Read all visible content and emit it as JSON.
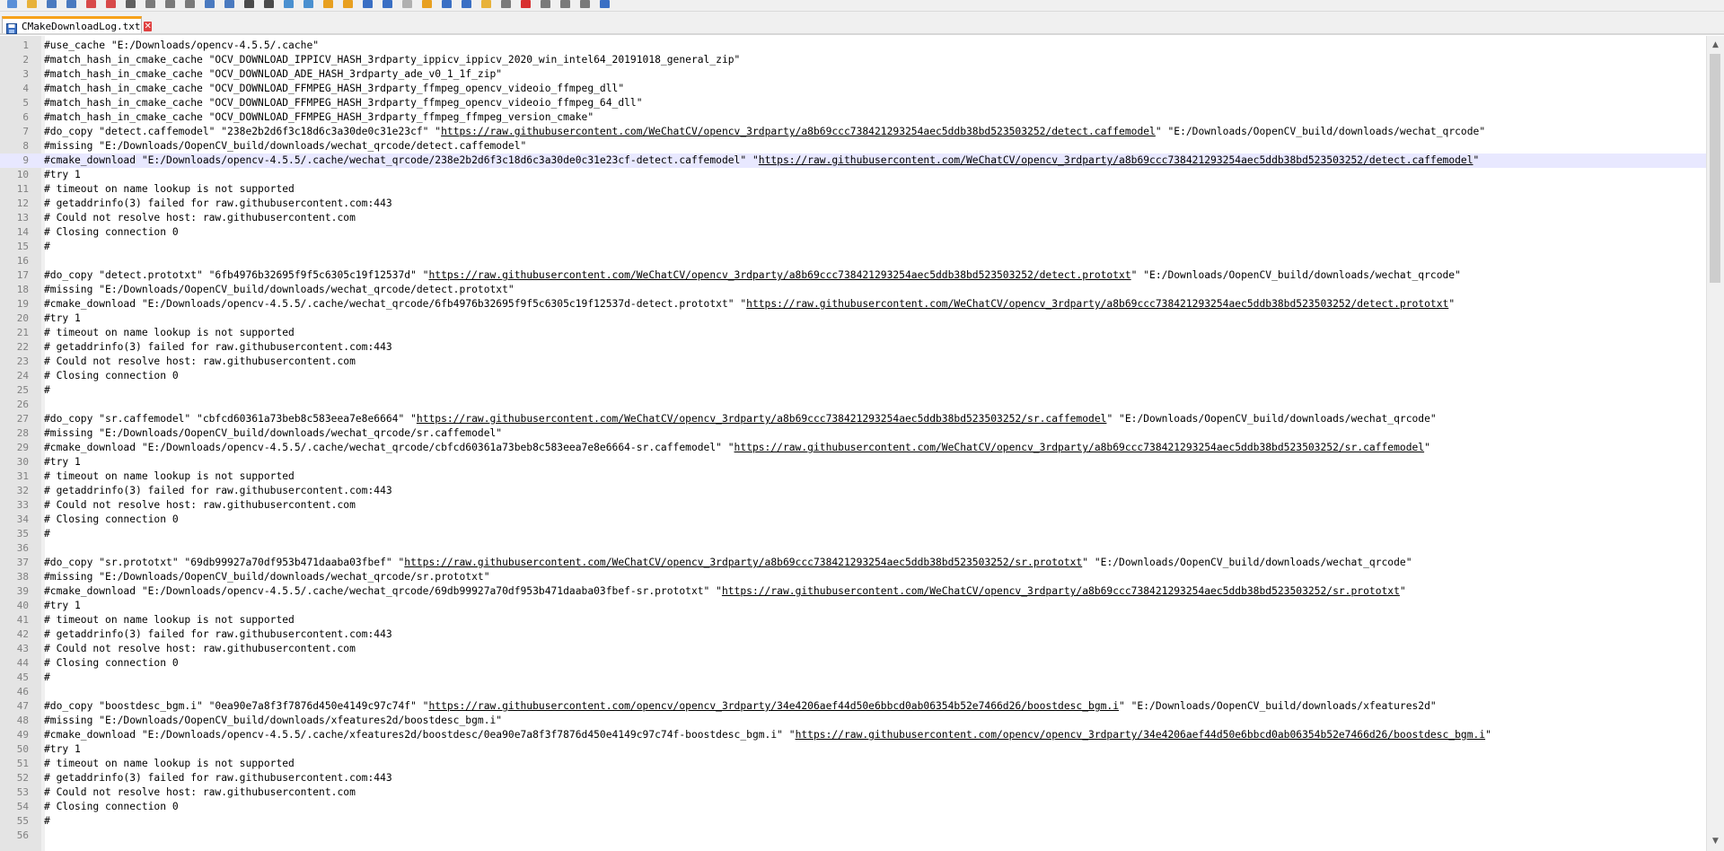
{
  "toolbar": {
    "icons": [
      "new-file-icon",
      "open-icon",
      "save-icon",
      "save-all-icon",
      "close-icon",
      "close-all-icon",
      "print-icon",
      "cut-icon",
      "copy-icon",
      "paste-icon",
      "undo-icon",
      "redo-icon",
      "find-icon",
      "replace-icon",
      "zoom-in-icon",
      "zoom-out-icon",
      "sync-vertical-icon",
      "sync-horizontal-icon",
      "word-wrap-icon",
      "show-all-chars-icon",
      "indent-guide-icon",
      "udl-icon",
      "doc-map-icon",
      "function-list-icon",
      "folder-workspace-icon",
      "monitoring-icon",
      "record-macro-icon",
      "stop-record-icon",
      "play-macro-icon",
      "run-macro-icon",
      "save-macro-icon"
    ]
  },
  "tab": {
    "title": "CMakeDownloadLog.txt",
    "close_glyph": "✕"
  },
  "colors": {
    "accent": "#f7a21a",
    "current_line": "#e8e8ff",
    "gutter": "#e4e4e4"
  },
  "current_line": 9,
  "lines": [
    {
      "n": "1",
      "text": "#use_cache \"E:/Downloads/opencv-4.5.5/.cache\""
    },
    {
      "n": "2",
      "text": "#match_hash_in_cmake_cache \"OCV_DOWNLOAD_IPPICV_HASH_3rdparty_ippicv_ippicv_2020_win_intel64_20191018_general_zip\""
    },
    {
      "n": "3",
      "text": "#match_hash_in_cmake_cache \"OCV_DOWNLOAD_ADE_HASH_3rdparty_ade_v0_1_1f_zip\""
    },
    {
      "n": "4",
      "text": "#match_hash_in_cmake_cache \"OCV_DOWNLOAD_FFMPEG_HASH_3rdparty_ffmpeg_opencv_videoio_ffmpeg_dll\""
    },
    {
      "n": "5",
      "text": "#match_hash_in_cmake_cache \"OCV_DOWNLOAD_FFMPEG_HASH_3rdparty_ffmpeg_opencv_videoio_ffmpeg_64_dll\""
    },
    {
      "n": "6",
      "text": "#match_hash_in_cmake_cache \"OCV_DOWNLOAD_FFMPEG_HASH_3rdparty_ffmpeg_ffmpeg_version_cmake\""
    },
    {
      "n": "7",
      "pre": "#do_copy \"detect.caffemodel\" \"238e2b2d6f3c18d6c3a30de0c31e23cf\" \"",
      "url": "https://raw.githubusercontent.com/WeChatCV/opencv_3rdparty/a8b69ccc738421293254aec5ddb38bd523503252/detect.caffemodel",
      "post": "\" \"E:/Downloads/OopenCV_build/downloads/wechat_qrcode\""
    },
    {
      "n": "8",
      "text": "#missing \"E:/Downloads/OopenCV_build/downloads/wechat_qrcode/detect.caffemodel\""
    },
    {
      "n": "9",
      "pre": "#cmake_download \"E:/Downloads/opencv-4.5.5/.cache/wechat_qrcode/238e2b2d6f3c18d6c3a30de0c31e23cf-detect.caffemodel\" \"",
      "url": "https://raw.githubusercontent.com/WeChatCV/opencv_3rdparty/a8b69ccc738421293254aec5ddb38bd523503252/detect.caffemodel",
      "post": "\""
    },
    {
      "n": "10",
      "text": "#try 1"
    },
    {
      "n": "11",
      "text": "# timeout on name lookup is not supported"
    },
    {
      "n": "12",
      "text": "# getaddrinfo(3) failed for raw.githubusercontent.com:443"
    },
    {
      "n": "13",
      "text": "# Could not resolve host: raw.githubusercontent.com"
    },
    {
      "n": "14",
      "text": "# Closing connection 0"
    },
    {
      "n": "15",
      "text": "#"
    },
    {
      "n": "16",
      "text": ""
    },
    {
      "n": "17",
      "pre": "#do_copy \"detect.prototxt\" \"6fb4976b32695f9f5c6305c19f12537d\" \"",
      "url": "https://raw.githubusercontent.com/WeChatCV/opencv_3rdparty/a8b69ccc738421293254aec5ddb38bd523503252/detect.prototxt",
      "post": "\" \"E:/Downloads/OopenCV_build/downloads/wechat_qrcode\""
    },
    {
      "n": "18",
      "text": "#missing \"E:/Downloads/OopenCV_build/downloads/wechat_qrcode/detect.prototxt\""
    },
    {
      "n": "19",
      "pre": "#cmake_download \"E:/Downloads/opencv-4.5.5/.cache/wechat_qrcode/6fb4976b32695f9f5c6305c19f12537d-detect.prototxt\" \"",
      "url": "https://raw.githubusercontent.com/WeChatCV/opencv_3rdparty/a8b69ccc738421293254aec5ddb38bd523503252/detect.prototxt",
      "post": "\""
    },
    {
      "n": "20",
      "text": "#try 1"
    },
    {
      "n": "21",
      "text": "# timeout on name lookup is not supported"
    },
    {
      "n": "22",
      "text": "# getaddrinfo(3) failed for raw.githubusercontent.com:443"
    },
    {
      "n": "23",
      "text": "# Could not resolve host: raw.githubusercontent.com"
    },
    {
      "n": "24",
      "text": "# Closing connection 0"
    },
    {
      "n": "25",
      "text": "#"
    },
    {
      "n": "26",
      "text": ""
    },
    {
      "n": "27",
      "pre": "#do_copy \"sr.caffemodel\" \"cbfcd60361a73beb8c583eea7e8e6664\" \"",
      "url": "https://raw.githubusercontent.com/WeChatCV/opencv_3rdparty/a8b69ccc738421293254aec5ddb38bd523503252/sr.caffemodel",
      "post": "\" \"E:/Downloads/OopenCV_build/downloads/wechat_qrcode\""
    },
    {
      "n": "28",
      "text": "#missing \"E:/Downloads/OopenCV_build/downloads/wechat_qrcode/sr.caffemodel\""
    },
    {
      "n": "29",
      "pre": "#cmake_download \"E:/Downloads/opencv-4.5.5/.cache/wechat_qrcode/cbfcd60361a73beb8c583eea7e8e6664-sr.caffemodel\" \"",
      "url": "https://raw.githubusercontent.com/WeChatCV/opencv_3rdparty/a8b69ccc738421293254aec5ddb38bd523503252/sr.caffemodel",
      "post": "\""
    },
    {
      "n": "30",
      "text": "#try 1"
    },
    {
      "n": "31",
      "text": "# timeout on name lookup is not supported"
    },
    {
      "n": "32",
      "text": "# getaddrinfo(3) failed for raw.githubusercontent.com:443"
    },
    {
      "n": "33",
      "text": "# Could not resolve host: raw.githubusercontent.com"
    },
    {
      "n": "34",
      "text": "# Closing connection 0"
    },
    {
      "n": "35",
      "text": "#"
    },
    {
      "n": "36",
      "text": ""
    },
    {
      "n": "37",
      "pre": "#do_copy \"sr.prototxt\" \"69db99927a70df953b471daaba03fbef\" \"",
      "url": "https://raw.githubusercontent.com/WeChatCV/opencv_3rdparty/a8b69ccc738421293254aec5ddb38bd523503252/sr.prototxt",
      "post": "\" \"E:/Downloads/OopenCV_build/downloads/wechat_qrcode\""
    },
    {
      "n": "38",
      "text": "#missing \"E:/Downloads/OopenCV_build/downloads/wechat_qrcode/sr.prototxt\""
    },
    {
      "n": "39",
      "pre": "#cmake_download \"E:/Downloads/opencv-4.5.5/.cache/wechat_qrcode/69db99927a70df953b471daaba03fbef-sr.prototxt\" \"",
      "url": "https://raw.githubusercontent.com/WeChatCV/opencv_3rdparty/a8b69ccc738421293254aec5ddb38bd523503252/sr.prototxt",
      "post": "\""
    },
    {
      "n": "40",
      "text": "#try 1"
    },
    {
      "n": "41",
      "text": "# timeout on name lookup is not supported"
    },
    {
      "n": "42",
      "text": "# getaddrinfo(3) failed for raw.githubusercontent.com:443"
    },
    {
      "n": "43",
      "text": "# Could not resolve host: raw.githubusercontent.com"
    },
    {
      "n": "44",
      "text": "# Closing connection 0"
    },
    {
      "n": "45",
      "text": "#"
    },
    {
      "n": "46",
      "text": ""
    },
    {
      "n": "47",
      "pre": "#do_copy \"boostdesc_bgm.i\" \"0ea90e7a8f3f7876d450e4149c97c74f\" \"",
      "url": "https://raw.githubusercontent.com/opencv/opencv_3rdparty/34e4206aef44d50e6bbcd0ab06354b52e7466d26/boostdesc_bgm.i",
      "post": "\" \"E:/Downloads/OopenCV_build/downloads/xfeatures2d\""
    },
    {
      "n": "48",
      "text": "#missing \"E:/Downloads/OopenCV_build/downloads/xfeatures2d/boostdesc_bgm.i\""
    },
    {
      "n": "49",
      "pre": "#cmake_download \"E:/Downloads/opencv-4.5.5/.cache/xfeatures2d/boostdesc/0ea90e7a8f3f7876d450e4149c97c74f-boostdesc_bgm.i\" \"",
      "url": "https://raw.githubusercontent.com/opencv/opencv_3rdparty/34e4206aef44d50e6bbcd0ab06354b52e7466d26/boostdesc_bgm.i",
      "post": "\""
    },
    {
      "n": "50",
      "text": "#try 1"
    },
    {
      "n": "51",
      "text": "# timeout on name lookup is not supported"
    },
    {
      "n": "52",
      "text": "# getaddrinfo(3) failed for raw.githubusercontent.com:443"
    },
    {
      "n": "53",
      "text": "# Could not resolve host: raw.githubusercontent.com"
    },
    {
      "n": "54",
      "text": "# Closing connection 0"
    },
    {
      "n": "55",
      "text": "#"
    },
    {
      "n": "56",
      "text": ""
    }
  ]
}
